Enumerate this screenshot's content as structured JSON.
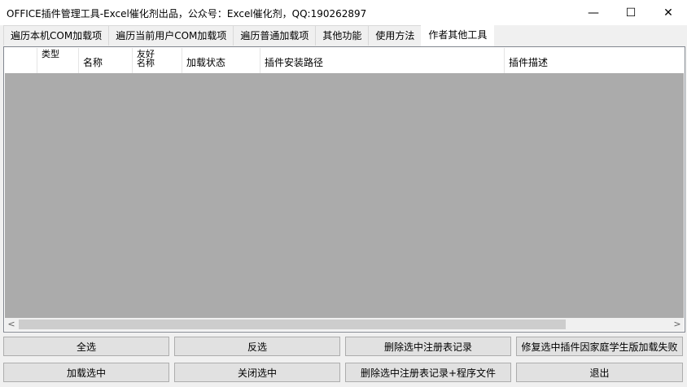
{
  "window": {
    "title": "OFFICE插件管理工具-Excel催化剂出品，公众号：Excel催化剂，QQ:190262897",
    "minimize": "—",
    "maximize": "☐",
    "close": "✕"
  },
  "tabs": [
    {
      "label": "遍历本机COM加载项"
    },
    {
      "label": "遍历当前用户COM加载项"
    },
    {
      "label": "遍历普通加载项"
    },
    {
      "label": "其他功能"
    },
    {
      "label": "使用方法"
    },
    {
      "label": "作者其他工具"
    }
  ],
  "grid": {
    "columns": [
      "类型",
      "名称",
      "友好名称",
      "加载状态",
      "插件安装路径",
      "插件描述"
    ]
  },
  "scrollbar": {
    "left_arrow": "<",
    "right_arrow": ">"
  },
  "buttons": {
    "select_all": "全选",
    "invert_select": "反选",
    "delete_reg": "删除选中注册表记录",
    "repair": "修复选中插件因家庭学生版加载失败",
    "load_selected": "加载选中",
    "close_selected": "关闭选中",
    "delete_reg_files": "删除选中注册表记录+程序文件",
    "exit": "退出"
  }
}
